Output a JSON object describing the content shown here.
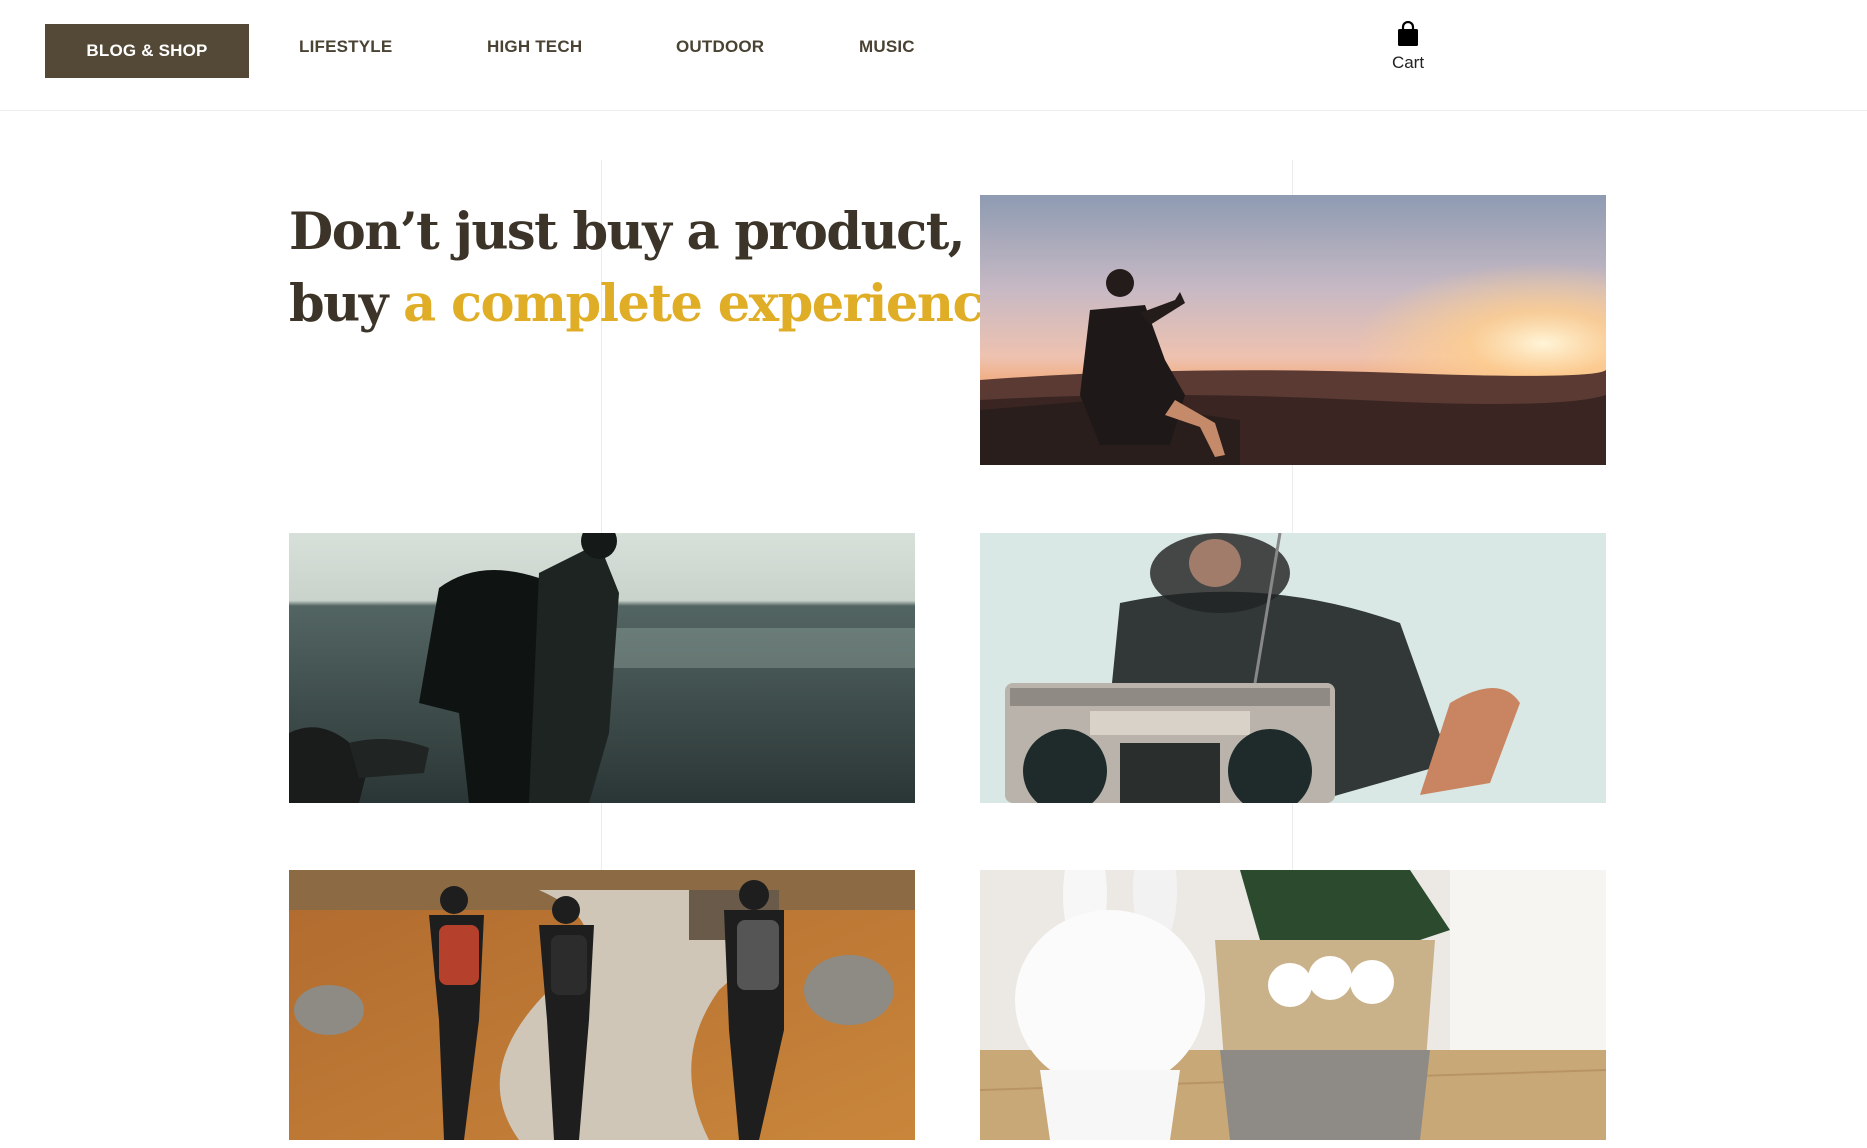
{
  "header": {
    "brand_label": "BLOG & SHOP",
    "nav": [
      {
        "label": "LIFESTYLE"
      },
      {
        "label": "HIGH TECH"
      },
      {
        "label": "OUTDOOR"
      },
      {
        "label": "MUSIC"
      }
    ],
    "cart": {
      "icon": "shopping-bag-icon",
      "label": "Cart"
    }
  },
  "hero": {
    "line1_plain": "Don’t just buy ",
    "line1_strong": "a product,",
    "line2_plain": "buy ",
    "line2_accent": "a complete experience!"
  },
  "colors": {
    "brand_background": "#534936",
    "nav_text": "#4a4233",
    "headline_text": "#3c3428",
    "accent": "#e0ad26"
  },
  "gallery": [
    {
      "subject": "man photographing sunset from mountain"
    },
    {
      "subject": "hiker with backpack by the sea"
    },
    {
      "subject": "person relaxing with boombox radio"
    },
    {
      "subject": "three hikers walking on trail"
    },
    {
      "subject": "white rabbit lamp and plant basket"
    }
  ]
}
